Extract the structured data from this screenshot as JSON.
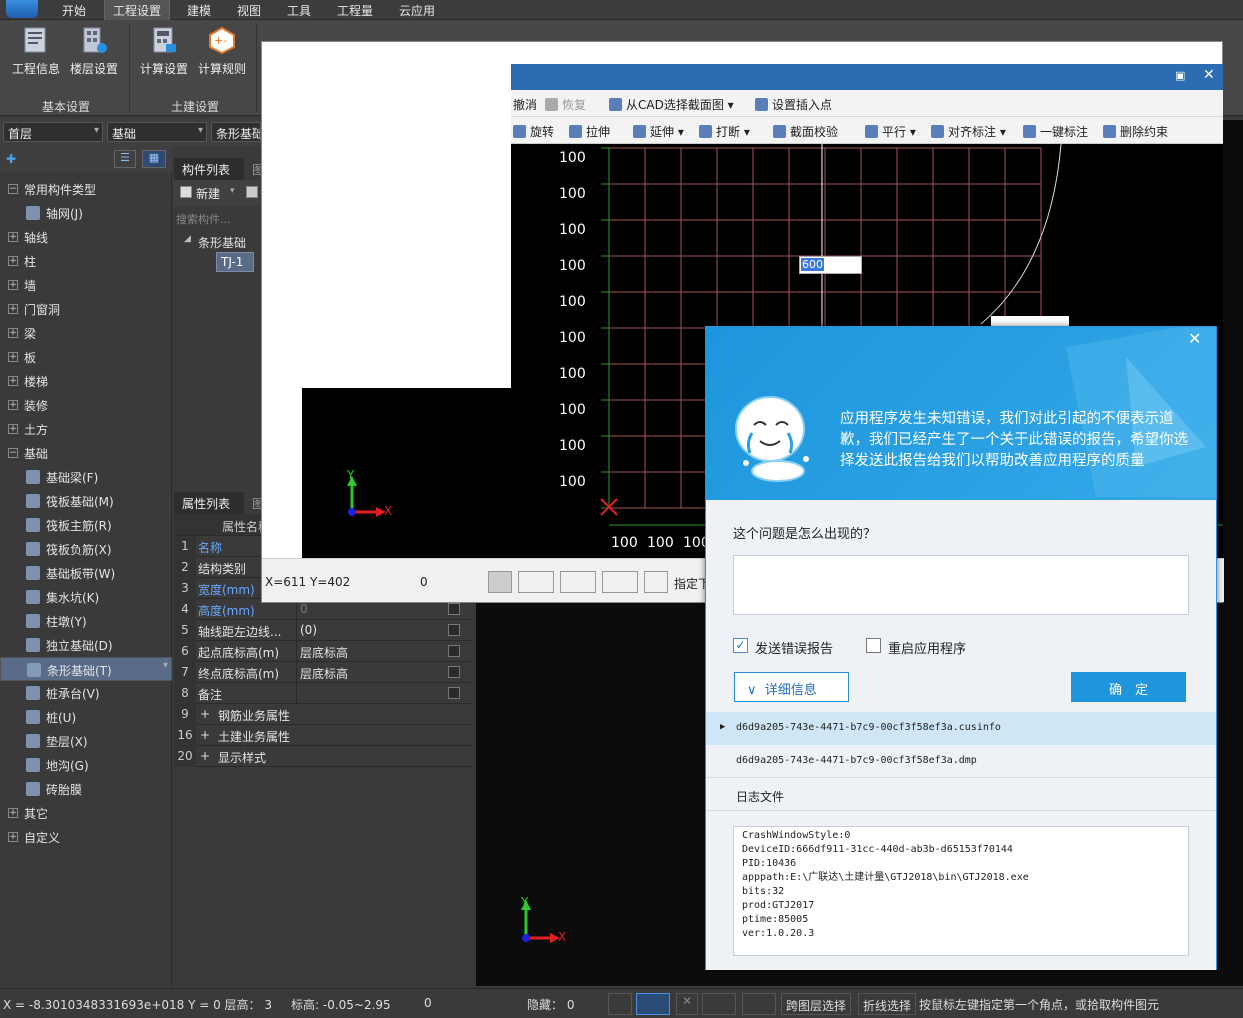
{
  "menu": [
    "开始",
    "工程设置",
    "建模",
    "视图",
    "工具",
    "工程量",
    "云应用"
  ],
  "ribbon": {
    "buttons": [
      "工程信息",
      "楼层设置",
      "计算设置",
      "计算规则"
    ],
    "groups": [
      "基本设置",
      "土建设置"
    ]
  },
  "selectors": {
    "floor": "首层",
    "category": "基础",
    "sub": "条形基础"
  },
  "tree": {
    "root": "常用构件类型",
    "items": [
      {
        "label": "轴网(J)",
        "child": true
      },
      {
        "label": "轴线"
      },
      {
        "label": "柱"
      },
      {
        "label": "墙"
      },
      {
        "label": "门窗洞"
      },
      {
        "label": "梁"
      },
      {
        "label": "板"
      },
      {
        "label": "楼梯"
      },
      {
        "label": "装修"
      },
      {
        "label": "土方"
      },
      {
        "label": "基础",
        "expanded": true
      },
      {
        "label": "基础梁(F)",
        "child": true
      },
      {
        "label": "筏板基础(M)",
        "child": true
      },
      {
        "label": "筏板主筋(R)",
        "child": true
      },
      {
        "label": "筏板负筋(X)",
        "child": true
      },
      {
        "label": "基础板带(W)",
        "child": true
      },
      {
        "label": "集水坑(K)",
        "child": true
      },
      {
        "label": "柱墩(Y)",
        "child": true
      },
      {
        "label": "独立基础(D)",
        "child": true
      },
      {
        "label": "条形基础(T)",
        "child": true,
        "selected": true
      },
      {
        "label": "桩承台(V)",
        "child": true
      },
      {
        "label": "桩(U)",
        "child": true
      },
      {
        "label": "垫层(X)",
        "child": true
      },
      {
        "label": "地沟(G)",
        "child": true
      },
      {
        "label": "砖胎膜",
        "child": true
      },
      {
        "label": "其它"
      },
      {
        "label": "自定义"
      }
    ]
  },
  "complist": {
    "tab": "构件列表",
    "tab2": "图",
    "new_label": "新建",
    "search_placeholder": "搜索构件...",
    "group": "条形基础",
    "item": "TJ-1"
  },
  "props": {
    "tab": "属性列表",
    "tab2": "图",
    "header": "属性名称",
    "rows": [
      {
        "num": "1",
        "name": "名称",
        "val": "",
        "blue": true
      },
      {
        "num": "2",
        "name": "结构类别",
        "val": ""
      },
      {
        "num": "3",
        "name": "宽度(mm)",
        "val": "",
        "blue": true
      },
      {
        "num": "4",
        "name": "高度(mm)",
        "val": "0",
        "blue": true
      },
      {
        "num": "5",
        "name": "轴线距左边线...",
        "val": "(0)"
      },
      {
        "num": "6",
        "name": "起点底标高(m)",
        "val": "层底标高"
      },
      {
        "num": "7",
        "name": "终点底标高(m)",
        "val": "层底标高"
      },
      {
        "num": "8",
        "name": "备注",
        "val": ""
      },
      {
        "num": "9",
        "name": "钢筋业务属性",
        "val": "",
        "plus": true
      },
      {
        "num": "16",
        "name": "土建业务属性",
        "val": "",
        "plus": true
      },
      {
        "num": "20",
        "name": "显示样式",
        "val": "",
        "plus": true
      }
    ]
  },
  "cad": {
    "tb1": [
      "撤消",
      "恢复",
      "从CAD选择截面图",
      "设置插入点"
    ],
    "tb2": [
      "旋转",
      "拉伸",
      "延伸",
      "打断",
      "截面校验",
      "平行",
      "对齐标注",
      "一键标注",
      "删除约束"
    ],
    "labels_y": [
      "100",
      "100",
      "100",
      "100",
      "100",
      "100",
      "100",
      "100",
      "100",
      "100"
    ],
    "labels_x": [
      "100",
      "100",
      "100"
    ],
    "input_value": "600",
    "status_coords": "X=611 Y=402",
    "status_zero": "0",
    "status_hint": "指定下"
  },
  "error": {
    "message": "应用程序发生未知错误，我们对此引起的不便表示道歉，我们已经产生了一个关于此错误的报告，希望你选择发送此报告给我们以帮助改善应用程序的质量",
    "question": "这个问题是怎么出现的？",
    "send_report": "发送错误报告",
    "restart": "重启应用程序",
    "details": "详细信息",
    "ok": "确　定",
    "file1": "d6d9a205-743e-4471-b7c9-00cf3f58ef3a.cusinfo",
    "file2": "d6d9a205-743e-4471-b7c9-00cf3f58ef3a.dmp",
    "log_title": "日志文件",
    "log": [
      "CrashWindowStyle:0",
      "DeviceID:666df911-31cc-440d-ab3b-d65153f70144",
      "PID:10436",
      "apppath:E:\\广联达\\土建计量\\GTJ2018\\bin\\GTJ2018.exe",
      "bits:32",
      "prod:GTJ2017",
      "ptime:85005",
      "ver:1.0.20.3"
    ]
  },
  "status": {
    "coords": "X = -8.3010348331693e+018 Y = 0 层高：  3",
    "elev": "标高: -0.05~2.95",
    "zero": "0",
    "hidden": "隐藏：  0",
    "cross": "跨图层选择",
    "polyline": "折线选择",
    "hint": "按鼠标左键指定第一个角点，或拾取构件图元"
  },
  "axis": {
    "x": "X",
    "y": "Y"
  }
}
